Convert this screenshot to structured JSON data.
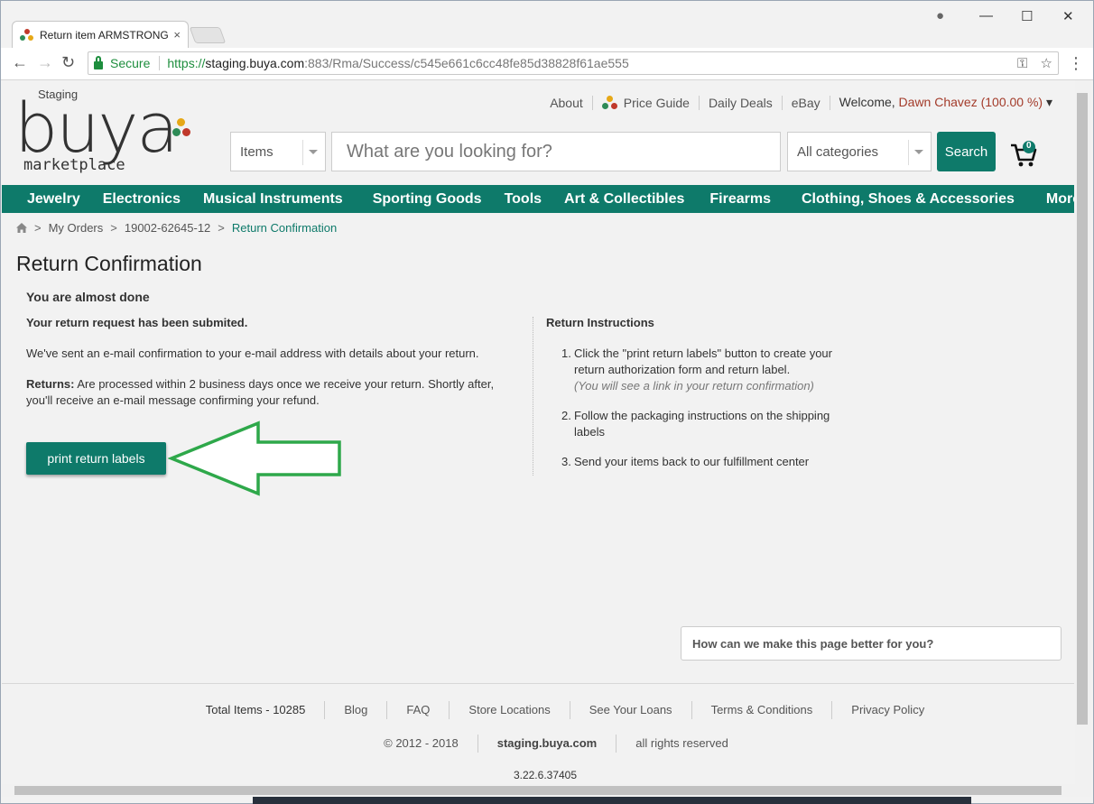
{
  "browser": {
    "tab_title": "Return item ARMSTRONG",
    "tab_close": "×",
    "secure_label": "Secure",
    "url_scheme": "https://",
    "url_host": "staging.buya.com",
    "url_path": ":883/Rma/Success/c545e661c6cc48fe85d38828f61ae555",
    "icons": {
      "back": "←",
      "forward": "→",
      "reload": "↻",
      "key": "⚿",
      "star": "☆",
      "menu": "⋮",
      "profile": "●",
      "minimize": "—",
      "maximize": "☐",
      "close": "✕"
    }
  },
  "header": {
    "logo_staging": "Staging",
    "logo_main": "buya",
    "logo_sub": "marketplace",
    "links": [
      "About",
      "Price Guide",
      "Daily Deals",
      "eBay"
    ],
    "welcome_prefix": "Welcome, ",
    "user_name": "Dawn Chavez (100.00 %)",
    "user_caret": "▾",
    "cart_count": "0"
  },
  "search": {
    "type_select": "Items",
    "placeholder": "What are you looking for?",
    "category_select": "All categories",
    "button_label": "Search"
  },
  "categories": [
    "Jewelry",
    "Electronics",
    "Musical Instruments",
    "Sporting Goods",
    "Tools",
    "Art & Collectibles",
    "Firearms",
    "Clothing, Shoes & Accessories",
    "More ▼"
  ],
  "breadcrumb": {
    "items": [
      "My Orders",
      "19002-62645-12"
    ],
    "current": "Return Confirmation",
    "separator": ">"
  },
  "main": {
    "title": "Return Confirmation",
    "almost_done": "You are almost done",
    "submitted": "Your return request has been submited.",
    "email_note": "We've sent an e-mail confirmation to your e-mail address with details about your return.",
    "returns_label": "Returns:",
    "returns_text": " Are processed within 2 business days once we receive your return. Shortly after, you'll receive an e-mail message confirming your refund.",
    "print_button": "print return labels"
  },
  "instructions": {
    "heading": "Return Instructions",
    "steps": [
      {
        "num": "1.",
        "text": "Click the \"print return labels\" button to create your return authorization form and return label.",
        "note": "(You will see a link in your return confirmation)"
      },
      {
        "num": "2.",
        "text": "Follow the packaging instructions on the shipping labels"
      },
      {
        "num": "3.",
        "text": "Send your items back to our fulfillment center"
      }
    ]
  },
  "feedback": {
    "label": "How can we make this page better for you?"
  },
  "footer": {
    "links": [
      "Total Items - 10285",
      "Blog",
      "FAQ",
      "Store Locations",
      "See Your Loans",
      "Terms & Conditions",
      "Privacy Policy"
    ],
    "copyright": "© 2012 - 2018",
    "domain": "staging.buya.com",
    "rights": "all rights reserved",
    "version": "3.22.6.37405"
  },
  "colors": {
    "brand_teal": "#0e7a6a",
    "user_red": "#a33b2a",
    "arrow_green": "#2ea84a"
  }
}
